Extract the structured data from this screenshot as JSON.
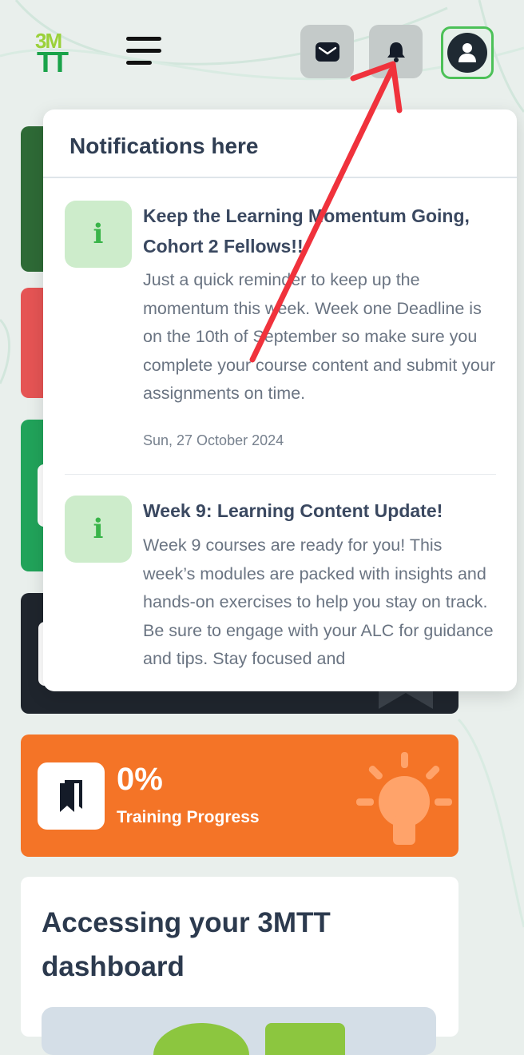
{
  "header": {
    "logo_top": "3M",
    "logo_bottom": "TT",
    "menu_icon": "hamburger-icon",
    "mail_icon": "envelope-icon",
    "bell_icon": "bell-icon",
    "profile_icon": "user-icon"
  },
  "colors": {
    "brand_green": "#1aa34a",
    "brand_lime": "#9bd13a",
    "annotation_arrow": "#f0323c",
    "orange_card": "#f47427"
  },
  "progress_card": {
    "icon": "bookmark-stack-icon",
    "percent": "0%",
    "label": "Training Progress",
    "decor_icon": "lightbulb-icon"
  },
  "access_card": {
    "title": "Accessing your 3MTT dashboard"
  },
  "notifications": {
    "heading": "Notifications here",
    "items": [
      {
        "icon": "info-icon",
        "icon_glyph": "i",
        "title": "Keep the Learning Momentum Going, Cohort 2 Fellows!!",
        "body": "Just a quick reminder to keep up the momentum this week. Week one Deadline is on the 10th of September so make sure you complete your course content and submit your assignments on time.",
        "date": "Sun, 27 October 2024"
      },
      {
        "icon": "info-icon",
        "icon_glyph": "i",
        "title": "Week 9: Learning Content Update!",
        "body": "Week 9 courses are ready for you! This week’s modules are packed with insights and hands-on exercises to help you stay on track. Be sure to engage with your ALC for guidance and tips. Stay focused and"
      }
    ]
  }
}
